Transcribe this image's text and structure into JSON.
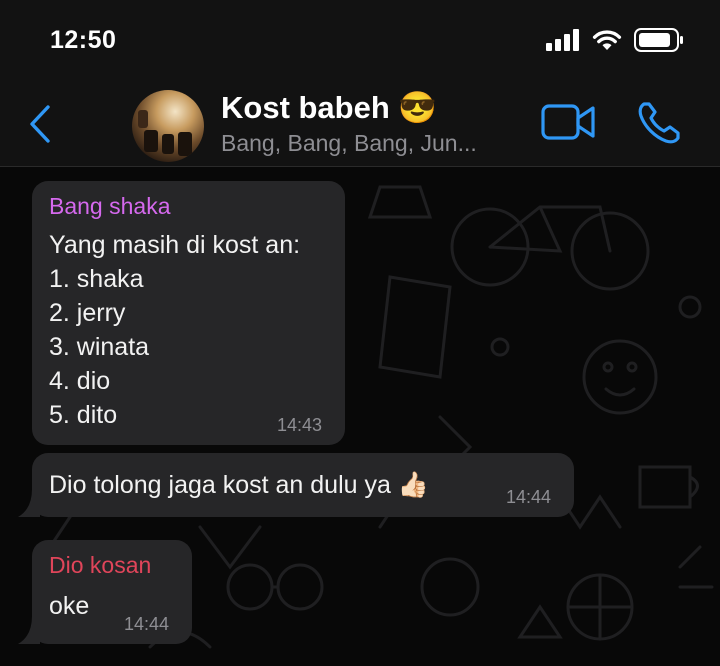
{
  "status_bar": {
    "time": "12:50"
  },
  "chat": {
    "title": "Kost babeh",
    "title_emoji": "😎",
    "participants": "Bang, Bang, Bang, Jun..."
  },
  "icons": {
    "back": "chevron-left-icon",
    "video": "video-camera-icon",
    "phone": "phone-icon"
  },
  "colors": {
    "accent": "#2f97f5",
    "bubble": "#262628",
    "sender_bang_shaka": "#d569ee",
    "sender_dio_kosan": "#e0455a"
  },
  "messages": [
    {
      "sender": "Bang shaka",
      "text": "Yang masih di kost an:\n1. shaka\n2. jerry\n3. winata\n4. dio\n5. dito",
      "time": "14:43"
    },
    {
      "text": "Dio tolong jaga kost an dulu ya 👍🏻",
      "time": "14:44"
    },
    {
      "sender": "Dio kosan",
      "text": "oke",
      "time": "14:44"
    }
  ]
}
